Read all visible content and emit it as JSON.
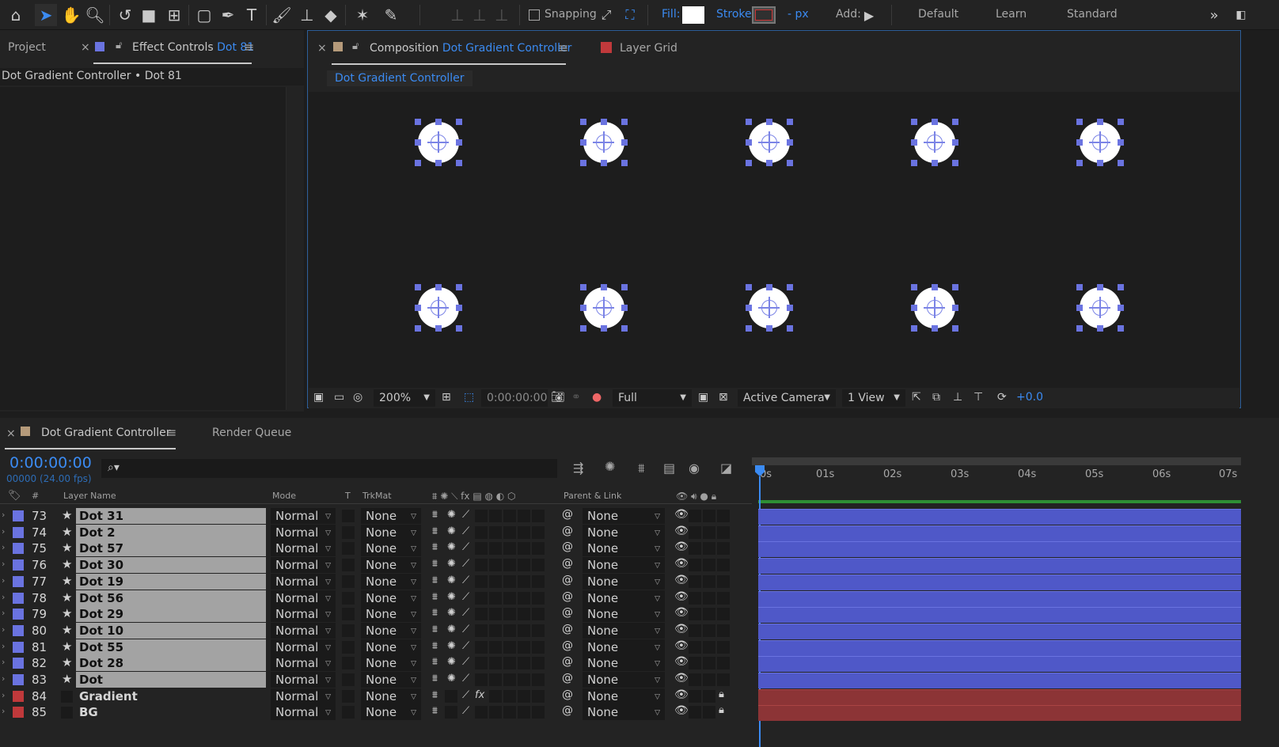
{
  "toolbar": {
    "snapping_label": "Snapping",
    "fill_label": "Fill:",
    "stroke_label": "Stroke:",
    "stroke_width": "- px",
    "add_label": "Add:",
    "workspaces": [
      "Default",
      "Learn",
      "Standard"
    ],
    "fill_color": "#ffffff",
    "accent": "#3b8bf2"
  },
  "left_panel": {
    "project_tab": "Project",
    "effect_controls_prefix": "Effect Controls",
    "effect_controls_layer": "Dot 81",
    "breadcrumb": "Dot Gradient Controller • Dot 81"
  },
  "viewer": {
    "comp_tab_prefix": "Composition",
    "comp_tab_name": "Dot Gradient Controller",
    "layer_tab_prefix": "Layer",
    "layer_tab_name": "Grid",
    "comp_chip": "Dot Gradient Controller",
    "zoom": "200%",
    "timecode": "0:00:00:00",
    "resolution": "Full",
    "camera": "Active Camera",
    "views": "1 View",
    "exposure": "+0.0"
  },
  "timeline": {
    "comp_tab": "Dot Gradient Controller",
    "render_queue_tab": "Render Queue",
    "current_time": "0:00:00:00",
    "frame_info": "00000 (24.00 fps)",
    "search_placeholder": "",
    "headers": {
      "num": "#",
      "layer_name": "Layer Name",
      "mode": "Mode",
      "t": "T",
      "trkmat": "TrkMat",
      "parent": "Parent & Link"
    },
    "ruler": [
      "0s",
      "01s",
      "02s",
      "03s",
      "04s",
      "05s",
      "06s",
      "07s"
    ],
    "layers": [
      {
        "num": "73",
        "name": "Dot 31",
        "mode": "Normal",
        "trkmat": "None",
        "parent": "None",
        "color": "#6a73e0",
        "type": "shape"
      },
      {
        "num": "74",
        "name": "Dot 2",
        "mode": "Normal",
        "trkmat": "None",
        "parent": "None",
        "color": "#6a73e0",
        "type": "shape"
      },
      {
        "num": "75",
        "name": "Dot 57",
        "mode": "Normal",
        "trkmat": "None",
        "parent": "None",
        "color": "#6a73e0",
        "type": "shape"
      },
      {
        "num": "76",
        "name": "Dot 30",
        "mode": "Normal",
        "trkmat": "None",
        "parent": "None",
        "color": "#6a73e0",
        "type": "shape"
      },
      {
        "num": "77",
        "name": "Dot 19",
        "mode": "Normal",
        "trkmat": "None",
        "parent": "None",
        "color": "#6a73e0",
        "type": "shape"
      },
      {
        "num": "78",
        "name": "Dot 56",
        "mode": "Normal",
        "trkmat": "None",
        "parent": "None",
        "color": "#6a73e0",
        "type": "shape"
      },
      {
        "num": "79",
        "name": "Dot 29",
        "mode": "Normal",
        "trkmat": "None",
        "parent": "None",
        "color": "#6a73e0",
        "type": "shape"
      },
      {
        "num": "80",
        "name": "Dot 10",
        "mode": "Normal",
        "trkmat": "None",
        "parent": "None",
        "color": "#6a73e0",
        "type": "shape"
      },
      {
        "num": "81",
        "name": "Dot 55",
        "mode": "Normal",
        "trkmat": "None",
        "parent": "None",
        "color": "#6a73e0",
        "type": "shape"
      },
      {
        "num": "82",
        "name": "Dot 28",
        "mode": "Normal",
        "trkmat": "None",
        "parent": "None",
        "color": "#6a73e0",
        "type": "shape"
      },
      {
        "num": "83",
        "name": "Dot",
        "mode": "Normal",
        "trkmat": "None",
        "parent": "None",
        "color": "#6a73e0",
        "type": "shape"
      },
      {
        "num": "84",
        "name": "Gradient",
        "mode": "Normal",
        "trkmat": "None",
        "parent": "None",
        "color": "#c0393b",
        "type": "solid"
      },
      {
        "num": "85",
        "name": "BG",
        "mode": "Normal",
        "trkmat": "None",
        "parent": "None",
        "color": "#c0393b",
        "type": "solid"
      }
    ]
  }
}
